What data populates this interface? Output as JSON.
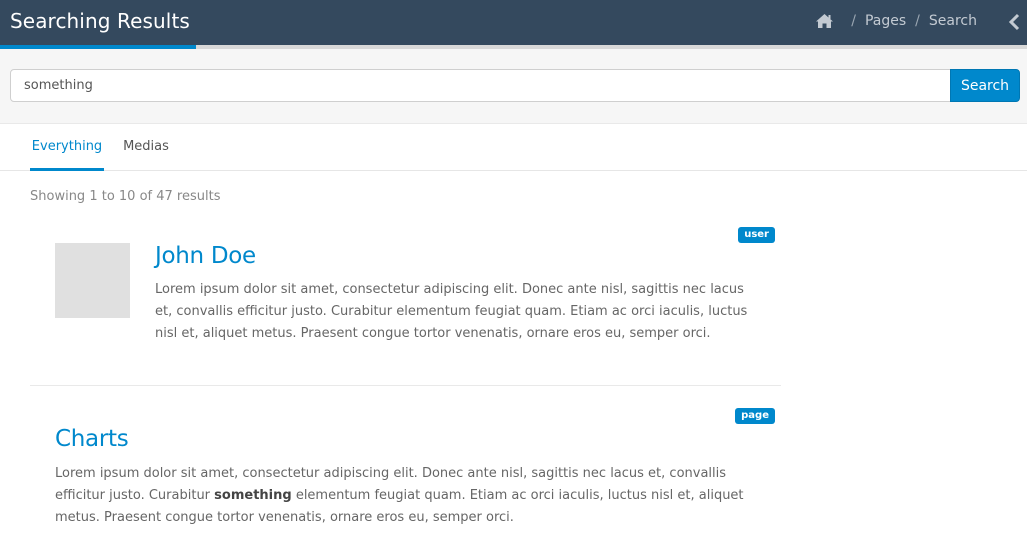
{
  "header": {
    "title": "Searching Results",
    "breadcrumb": [
      "Pages",
      "Search"
    ]
  },
  "search": {
    "value": "something",
    "button_label": "Search"
  },
  "tabs": [
    {
      "label": "Everything",
      "active": true
    },
    {
      "label": "Medias",
      "active": false
    }
  ],
  "results_summary": "Showing 1 to 10 of 47 results",
  "results": [
    {
      "badge": "user",
      "title": "John Doe",
      "text": "Lorem ipsum dolor sit amet, consectetur adipiscing elit. Donec ante nisl, sagittis nec lacus et, convallis efficitur justo. Curabitur elementum feugiat quam. Etiam ac orci iaculis, luctus nisl et, aliquet metus. Praesent congue tortor venenatis, ornare eros eu, semper orci."
    },
    {
      "badge": "page",
      "title": "Charts",
      "text_before": "Lorem ipsum dolor sit amet, consectetur adipiscing elit. Donec ante nisl, sagittis nec lacus et, convallis efficitur justo. Curabitur ",
      "highlight": "something",
      "text_after": " elementum feugiat quam. Etiam ac orci iaculis, luctus nisl et, aliquet metus. Praesent congue tortor venenatis, ornare eros eu, semper orci."
    }
  ],
  "colors": {
    "header_bg": "#34495e",
    "accent": "#0088cc"
  }
}
